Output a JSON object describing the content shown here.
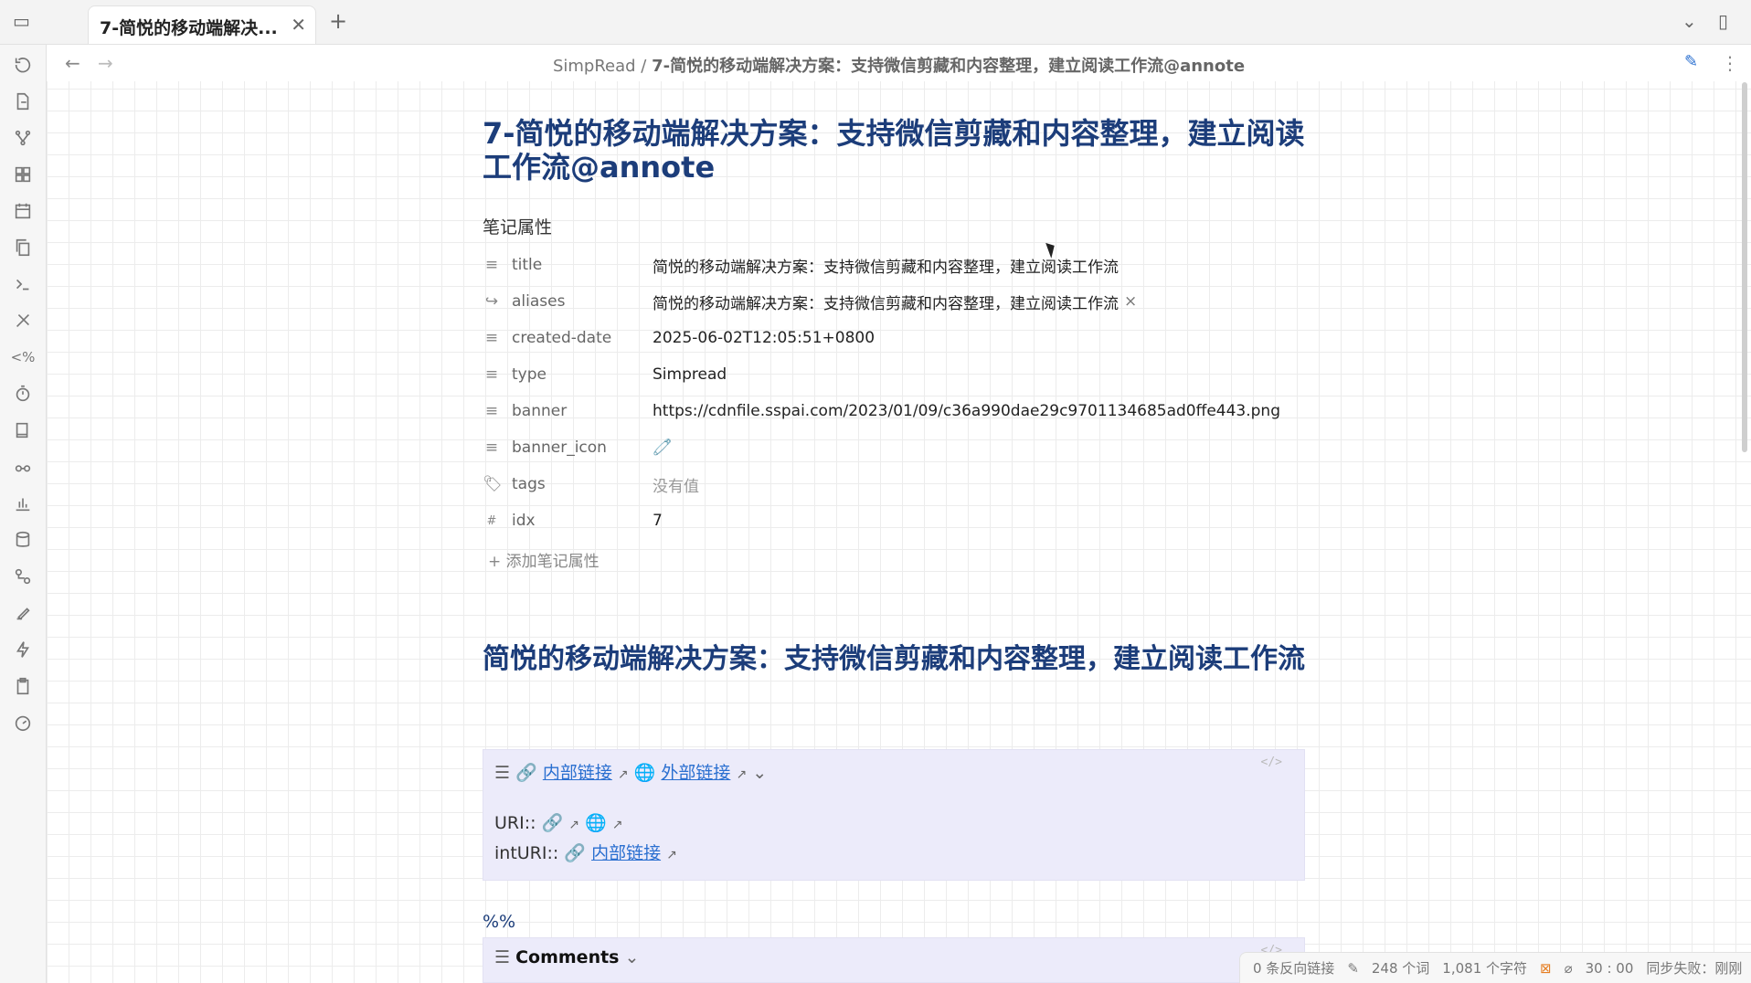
{
  "tabs": [
    {
      "label": "7-简悦的移动端解决..."
    }
  ],
  "breadcrumb": {
    "folder": "SimpRead",
    "sep": "/",
    "note": "7-简悦的移动端解决方案：支持微信剪藏和内容整理，建立阅读工作流@annote"
  },
  "note": {
    "title": "7-简悦的移动端解决方案：支持微信剪藏和内容整理，建立阅读工作流@annote",
    "properties_heading": "笔记属性",
    "properties": [
      {
        "key": "title",
        "icon": "text-icon",
        "value": "简悦的移动端解决方案：支持微信剪藏和内容整理，建立阅读工作流"
      },
      {
        "key": "aliases",
        "icon": "forward-icon",
        "value": "简悦的移动端解决方案：支持微信剪藏和内容整理，建立阅读工作流"
      },
      {
        "key": "created-date",
        "icon": "text-icon",
        "value": "2025-06-02T12:05:51+0800"
      },
      {
        "key": "type",
        "icon": "text-icon",
        "value": "Simpread"
      },
      {
        "key": "banner",
        "icon": "text-icon",
        "value": "https://cdnfile.sspai.com/2023/01/09/c36a990dae29c9701134685ad0ffe443.png"
      },
      {
        "key": "banner_icon",
        "icon": "text-icon",
        "value": "🧷"
      },
      {
        "key": "tags",
        "icon": "tag-icon",
        "value": "没有值"
      },
      {
        "key": "idx",
        "icon": "number-icon",
        "value": "7"
      }
    ],
    "add_property": "添加笔记属性",
    "heading2": "简悦的移动端解决方案：支持微信剪藏和内容整理，建立阅读工作流",
    "callout": {
      "internal_link": "内部链接",
      "external_link": "外部链接",
      "uri_label": "URI::",
      "inturi_label": "intURI::",
      "inturi_link": "内部链接"
    },
    "percent": "%%",
    "comments": "Comments"
  },
  "status": {
    "backlinks": "0 条反向链接",
    "words": "248 个词",
    "chars": "1,081 个字符",
    "timer": "30 : 00",
    "sync": "同步失败：刚刚"
  }
}
